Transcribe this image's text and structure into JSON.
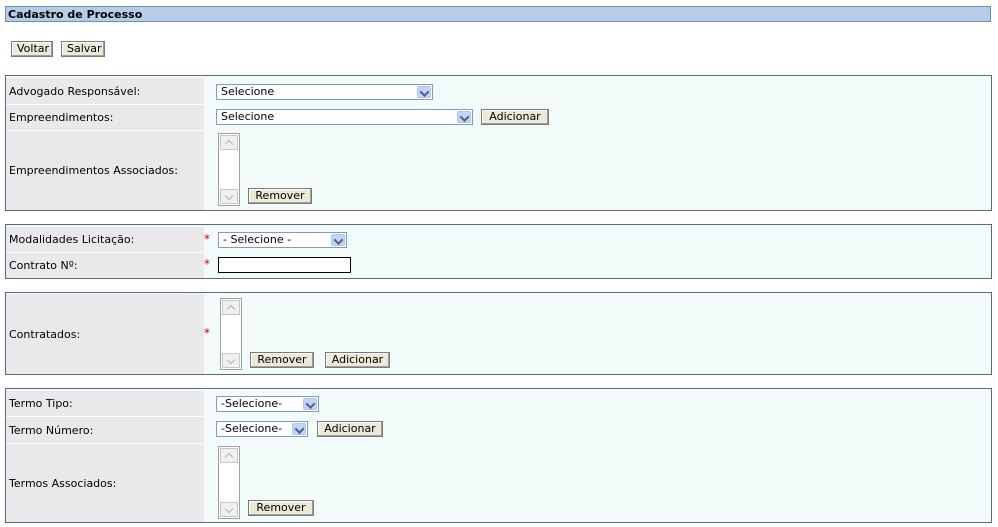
{
  "page": {
    "title": "Cadastro de Processo"
  },
  "toolbar": {
    "back_label": "Voltar",
    "save_label": "Salvar"
  },
  "section1": {
    "lawyer_label": "Advogado Responsável:",
    "lawyer_value": "Selecione",
    "enterprises_label": "Empreendimentos:",
    "enterprises_value": "Selecione",
    "add_label": "Adicionar",
    "associated_label": "Empreendimentos Associados:",
    "remove_label": "Remover"
  },
  "section2": {
    "modality_label": "Modalidades Licitação:",
    "modality_value": "- Selecione -",
    "contract_label": "Contrato Nº:",
    "contract_value": "",
    "required_mark": "*"
  },
  "section3": {
    "hired_label": "Contratados:",
    "remove_label": "Remover",
    "add_label": "Adicionar",
    "required_mark": "*"
  },
  "section4": {
    "term_type_label": "Termo Tipo:",
    "term_type_value": "-Selecione-",
    "term_number_label": "Termo Número:",
    "term_number_value": "-Selecione-",
    "add_label": "Adicionar",
    "associated_label": "Termos Associados:",
    "remove_label": "Remover"
  }
}
